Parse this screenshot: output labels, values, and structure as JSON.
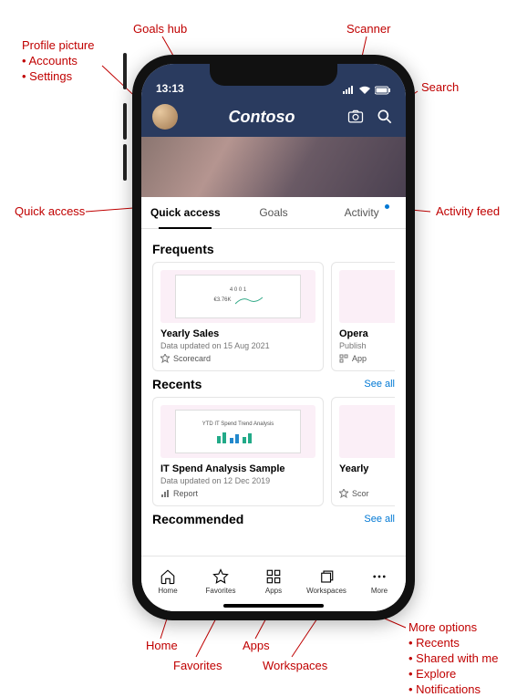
{
  "status": {
    "time": "13:13"
  },
  "header": {
    "brand": "Contoso"
  },
  "tabs": {
    "quick": "Quick access",
    "goals": "Goals",
    "activity": "Activity"
  },
  "sections": {
    "frequents": "Frequents",
    "recents": "Recents",
    "recommended": "Recommended",
    "see_all": "See all"
  },
  "cards": {
    "freq1": {
      "title": "Yearly Sales",
      "sub": "Data updated on 15 Aug 2021",
      "type": "Scorecard",
      "thumb_amount": "€3.76K"
    },
    "freq2": {
      "title": "Opera",
      "sub": "Publish",
      "type": "App"
    },
    "rec1": {
      "title": "IT Spend Analysis Sample",
      "sub": "Data updated on 12 Dec 2019",
      "type": "Report",
      "thumb_label": "YTD IT Spend Trend Analysis"
    },
    "rec2": {
      "title": "Yearly",
      "type": "Scor"
    }
  },
  "nav": {
    "home": "Home",
    "favorites": "Favorites",
    "apps": "Apps",
    "workspaces": "Workspaces",
    "more": "More"
  },
  "annotations": {
    "profile": {
      "title": "Profile picture",
      "b1": "Accounts",
      "b2": "Settings"
    },
    "goals": "Goals hub",
    "scanner": "Scanner",
    "search": "Search",
    "quick": "Quick access",
    "activity": "Activity feed",
    "home": "Home",
    "favorites": "Favorites",
    "apps": "Apps",
    "workspaces": "Workspaces",
    "more": {
      "title": "More options",
      "b1": "Recents",
      "b2": "Shared with me",
      "b3": "Explore",
      "b4": "Notifications"
    }
  }
}
